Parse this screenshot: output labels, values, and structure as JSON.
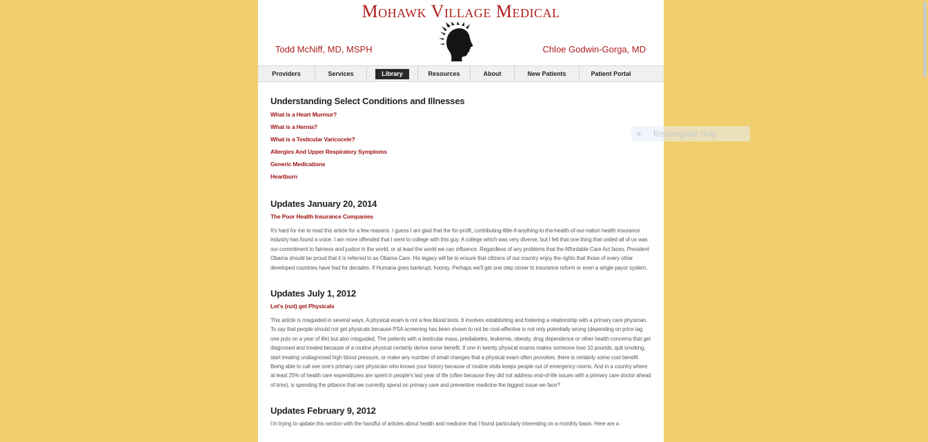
{
  "site": {
    "title": "Mohawk Village Medical",
    "doctor_left": "Todd McNiff, MD, MSPH",
    "doctor_right": "Chloe Godwin-Gorga, MD",
    "logo_icon": "mohawk-profile-logo-icon"
  },
  "nav": {
    "items": [
      {
        "label": "Providers"
      },
      {
        "label": "Services"
      },
      {
        "label": "Library"
      },
      {
        "label": "Resources"
      },
      {
        "label": "About"
      },
      {
        "label": "New Patients"
      },
      {
        "label": "Patient Portal"
      }
    ],
    "active": "Library"
  },
  "main": {
    "conditions": {
      "title": "Understanding Select Conditions and Illnesses",
      "links": [
        "What is a Heart Murmur?",
        "What is a Hernia?",
        "What is a Testicular Varicocele?",
        "Allergies And Upper Respiratory Symptoms",
        "Generic Medications",
        "Heartburn"
      ]
    },
    "updates": [
      {
        "title": "Updates January 20, 2014",
        "link": "The Poor Health Insurance Companies",
        "text": "It's hard for me to read this article for a few reasons.  I guess I am glad that the for-profit, contributing-little-if-anything-to-the-health-of-our-nation health insurance industry has found a voice.  I am more offended that I went to college with this guy.  A college which was very diverse, but I felt that one thing that united all of us was our commitment to fairness and justice in the world, or at least the world we can influence.  Regardless of any problems that the Affordable Care Act faces, President Obama should be proud that it is referred to as Obama Care.  His legacy will be to ensure that citizens of our country enjoy the rights that those of every other developed countries have had for decades.  If Humana goes bankrupt, hooray.  Perhaps we'll get one step closer to insurance reform or even a single payor system."
      },
      {
        "title": "Updates July 1, 2012",
        "link": "Let's (not) get Physicals",
        "text": "This article is misguided in several ways. A physical exam is not a few blood tests. It involves establishing and fostering a relationship with a primary care physician. To say that people should not get physicals because PSA screening has been shown to not be cost-effective is not only potentially wrong (depending on price tag one puts on a year of life) but also misguided. The patients with a testicular mass, prediabetes, leukemia, obesity, drug dependence or other health concerns that get diagnosed and treated because of a routine physical certainly derive some benefit. If one in twenty physical exams makes someone lose 10 pounds, quit smoking, start treating undiagnosed high blood pressure, or make any number of small changes that a physical exam often provokes, there is certainly some cost benefit. Being able to call see one's primary care physician who knows your history because of routine visits keeps people out of emergency rooms. And in a country where at least 25% of health care expenditures are spent in people's last year of life (often because they did not address end-of-life issues with a primary care doctor ahead of time), is spending the pittance that we currently spend on primary care and preventive medicine the biggest issue we face?"
      },
      {
        "title": "Updates February 9, 2012",
        "text": "I'm trying to update this section with the handful of articles about health and medicine that I found particularly interesting on a monthly basis. Here are a"
      }
    ]
  },
  "overlay": {
    "snip_label": "Rectangular Snip"
  }
}
